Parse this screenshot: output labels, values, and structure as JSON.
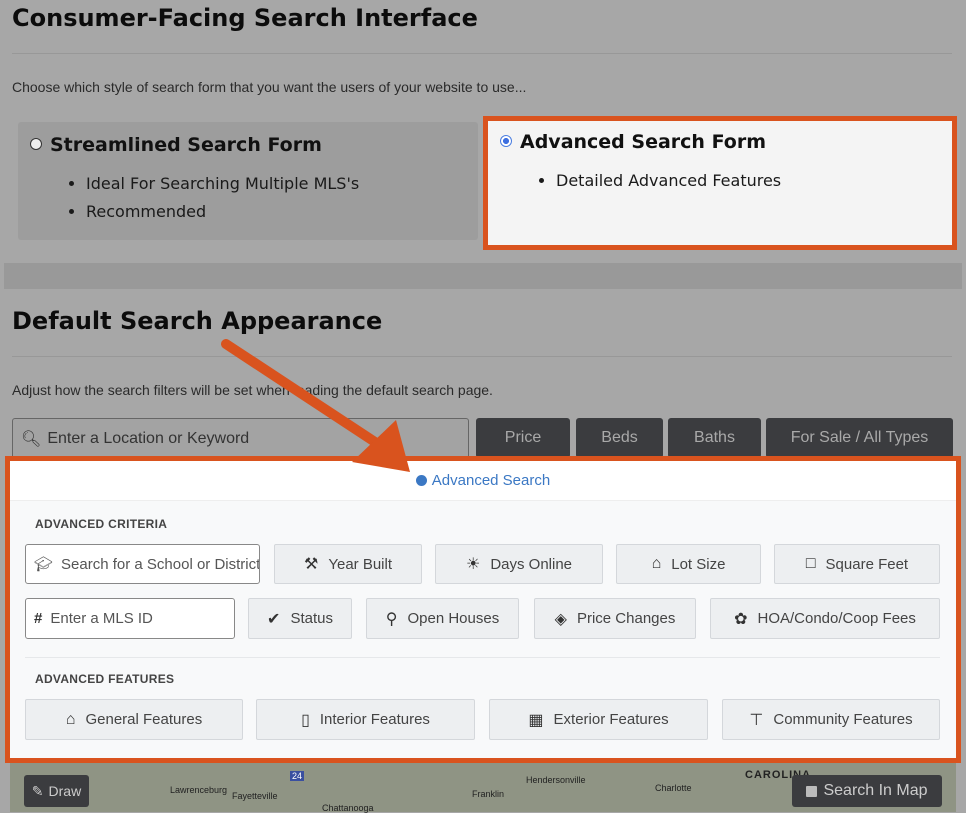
{
  "section1": {
    "title": "Consumer-Facing Search Interface",
    "description": "Choose which style of search form that you want the users of your website to use...",
    "options": [
      {
        "label": "Streamlined Search Form",
        "selected": false,
        "bullets": [
          "Ideal For Searching Multiple MLS's",
          "Recommended"
        ]
      },
      {
        "label": "Advanced Search Form",
        "selected": true,
        "bullets": [
          "Detailed Advanced Features"
        ]
      }
    ]
  },
  "section2": {
    "title": "Default Search Appearance",
    "description": "Adjust how the search filters will be set when loading the default search page."
  },
  "search": {
    "placeholder": "Enter a Location or Keyword",
    "buttons": [
      "Price",
      "Beds",
      "Baths",
      "For Sale / All Types"
    ]
  },
  "advanced": {
    "toggle": "Advanced Search",
    "criteria_label": "ADVANCED CRITERIA",
    "school_placeholder": "Search for a School or District",
    "mls_placeholder": "Enter a MLS ID",
    "criteria_row1": [
      {
        "label": "Year Built",
        "icon": "hammer-icon"
      },
      {
        "label": "Days Online",
        "icon": "sunrise-icon"
      },
      {
        "label": "Lot Size",
        "icon": "lot-icon"
      },
      {
        "label": "Square Feet",
        "icon": "square-icon"
      }
    ],
    "criteria_row2": [
      {
        "label": "Status",
        "icon": "check-icon"
      },
      {
        "label": "Open Houses",
        "icon": "key-icon"
      },
      {
        "label": "Price Changes",
        "icon": "tag-icon"
      },
      {
        "label": "HOA/Condo/Coop Fees",
        "icon": "hoa-icon"
      }
    ],
    "features_label": "ADVANCED FEATURES",
    "features": [
      {
        "label": "General Features",
        "icon": "home-icon"
      },
      {
        "label": "Interior Features",
        "icon": "door-icon"
      },
      {
        "label": "Exterior Features",
        "icon": "fence-icon"
      },
      {
        "label": "Community Features",
        "icon": "signpost-icon"
      }
    ]
  },
  "map": {
    "draw": "Draw",
    "search_in_map": "Search In Map",
    "labels": [
      "Lawrenceburg",
      "Fayetteville",
      "Chattanooga",
      "Franklin",
      "Hendersonville",
      "Charlotte",
      "CAROLINA",
      "24"
    ]
  },
  "colors": {
    "highlight": "#d9531e",
    "link": "#3b78c4"
  }
}
